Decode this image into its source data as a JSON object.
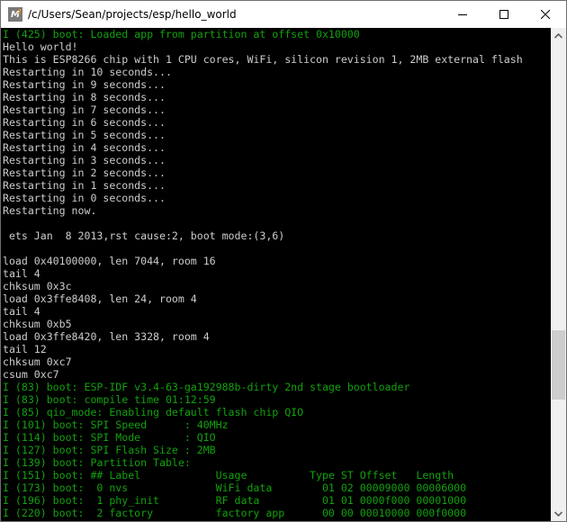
{
  "window": {
    "title": "/c/Users/Sean/projects/esp/hello_world",
    "icon": "msys2-icon",
    "controls": [
      "minimize",
      "maximize",
      "close"
    ]
  },
  "scrollbar": {
    "position_fraction": 0.73
  },
  "console": {
    "lines": [
      {
        "text": "I (425) boot: Loaded app from partition at offset 0x10000",
        "color": "green"
      },
      {
        "text": "Hello world!",
        "color": "white"
      },
      {
        "text": "This is ESP8266 chip with 1 CPU cores, WiFi, silicon revision 1, 2MB external flash",
        "color": "white"
      },
      {
        "text": "Restarting in 10 seconds...",
        "color": "white"
      },
      {
        "text": "Restarting in 9 seconds...",
        "color": "white"
      },
      {
        "text": "Restarting in 8 seconds...",
        "color": "white"
      },
      {
        "text": "Restarting in 7 seconds...",
        "color": "white"
      },
      {
        "text": "Restarting in 6 seconds...",
        "color": "white"
      },
      {
        "text": "Restarting in 5 seconds...",
        "color": "white"
      },
      {
        "text": "Restarting in 4 seconds...",
        "color": "white"
      },
      {
        "text": "Restarting in 3 seconds...",
        "color": "white"
      },
      {
        "text": "Restarting in 2 seconds...",
        "color": "white"
      },
      {
        "text": "Restarting in 1 seconds...",
        "color": "white"
      },
      {
        "text": "Restarting in 0 seconds...",
        "color": "white"
      },
      {
        "text": "Restarting now.",
        "color": "white"
      },
      {
        "text": "",
        "color": "white"
      },
      {
        "text": " ets Jan  8 2013,rst cause:2, boot mode:(3,6)",
        "color": "white"
      },
      {
        "text": "",
        "color": "white"
      },
      {
        "text": "load 0x40100000, len 7044, room 16",
        "color": "white"
      },
      {
        "text": "tail 4",
        "color": "white"
      },
      {
        "text": "chksum 0x3c",
        "color": "white"
      },
      {
        "text": "load 0x3ffe8408, len 24, room 4",
        "color": "white"
      },
      {
        "text": "tail 4",
        "color": "white"
      },
      {
        "text": "chksum 0xb5",
        "color": "white"
      },
      {
        "text": "load 0x3ffe8420, len 3328, room 4",
        "color": "white"
      },
      {
        "text": "tail 12",
        "color": "white"
      },
      {
        "text": "chksum 0xc7",
        "color": "white"
      },
      {
        "text": "csum 0xc7",
        "color": "white"
      },
      {
        "text": "I (83) boot: ESP-IDF v3.4-63-ga192988b-dirty 2nd stage bootloader",
        "color": "green"
      },
      {
        "text": "I (83) boot: compile time 01:12:59",
        "color": "green"
      },
      {
        "text": "I (85) qio_mode: Enabling default flash chip QIO",
        "color": "green"
      },
      {
        "text": "I (101) boot: SPI Speed      : 40MHz",
        "color": "green"
      },
      {
        "text": "I (114) boot: SPI Mode       : QIO",
        "color": "green"
      },
      {
        "text": "I (127) boot: SPI Flash Size : 2MB",
        "color": "green"
      },
      {
        "text": "I (139) boot: Partition Table:",
        "color": "green"
      },
      {
        "text": "I (151) boot: ## Label            Usage          Type ST Offset   Length",
        "color": "green"
      },
      {
        "text": "I (173) boot:  0 nvs              WiFi data        01 02 00009000 00006000",
        "color": "green"
      },
      {
        "text": "I (196) boot:  1 phy_init         RF data          01 01 0000f000 00001000",
        "color": "green"
      },
      {
        "text": "I (220) boot:  2 factory          factory app      00 00 00010000 000f0000",
        "color": "green"
      }
    ]
  }
}
